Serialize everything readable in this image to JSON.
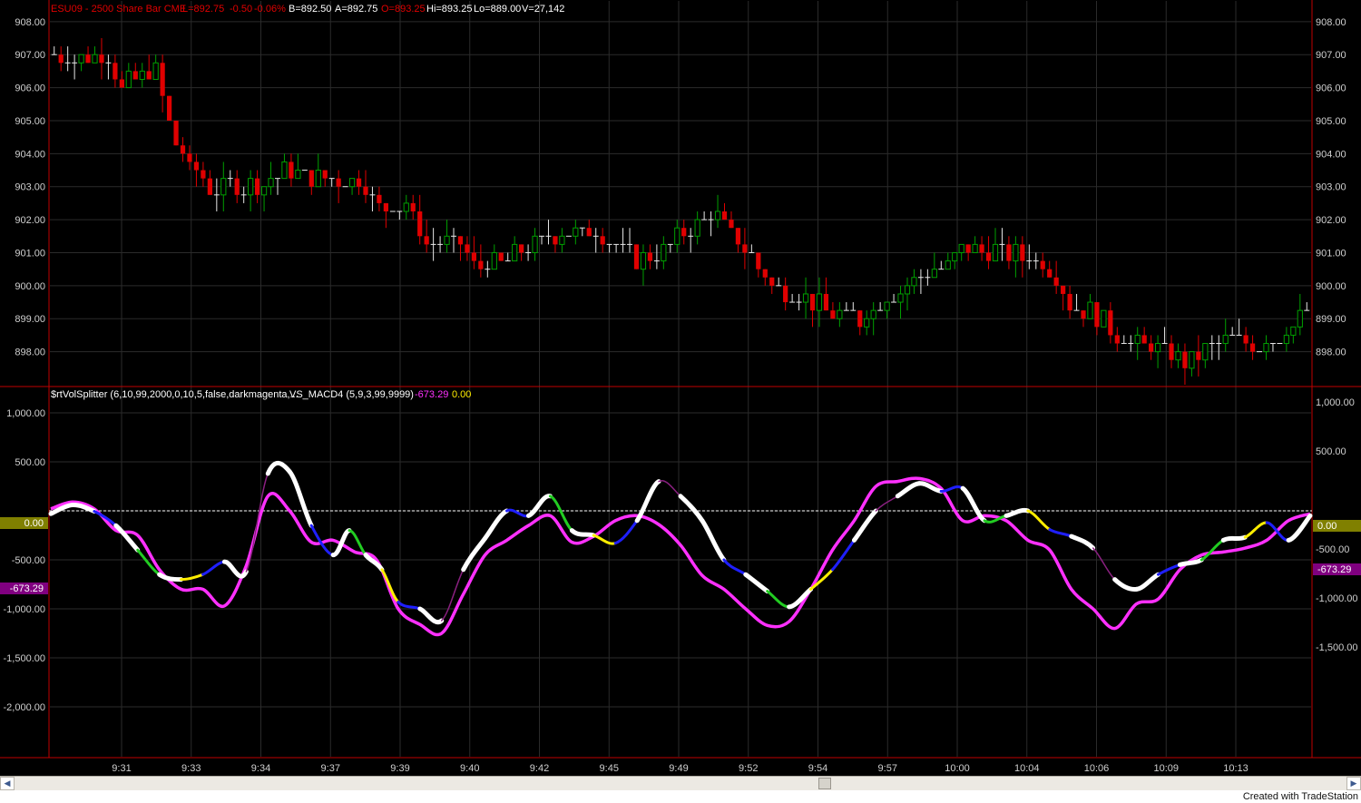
{
  "colors": {
    "background": "#000000",
    "border": "#c00000",
    "grid": "#2b2b2b",
    "axis_text": "#cfcfcf",
    "candle_up": "#00a000",
    "candle_down": "#e00000",
    "candle_doji": "#e8e8e8",
    "signal_line": "#ff30ff",
    "zero_line": "#ffffff",
    "zero_marker_bg": "#808000",
    "value_marker_bg": "#800080",
    "macd_colors": {
      "white": "#ffffff",
      "blue": "#1f1fff",
      "green": "#22cc22",
      "yellow": "#ffee00",
      "purple": "#8a2080"
    }
  },
  "header": {
    "symbol_info": "ESU09 - 2500 Share Bar  CME",
    "last": "L=892.75",
    "change": "-0.50",
    "change_pct": "-0.06%",
    "bid": "B=892.50",
    "ask": "A=892.75",
    "open": "O=893.25",
    "high": "Hi=893.25",
    "low": "Lo=889.00",
    "volume": "V=27,142"
  },
  "indicator_header": {
    "study": "$rtVolSplitter (6,10,99,2000,0,10,5,false,darkmagenta,...",
    "macd": "VS_MACD4 (5,9,3,99,9999)",
    "value1": "-673.29",
    "value2": "0.00"
  },
  "markers": {
    "left_zero": "0.00",
    "left_value": "-673.29",
    "right_zero": "0.00",
    "right_value": "-673.29"
  },
  "footer": {
    "scroll_left": "◀",
    "scroll_right": "▶",
    "credit": "Created with TradeStation"
  },
  "chart_data": [
    {
      "type": "candlestick",
      "price_ticks": [
        "908.00",
        "907.00",
        "906.00",
        "905.00",
        "904.00",
        "903.00",
        "902.00",
        "901.00",
        "900.00",
        "899.00",
        "898.00"
      ],
      "ylim": [
        897.0,
        908.6
      ],
      "time_labels": [
        "9:31",
        "9:33",
        "9:34",
        "9:37",
        "9:39",
        "9:40",
        "9:42",
        "9:45",
        "9:49",
        "9:52",
        "9:54",
        "9:57",
        "10:00",
        "10:04",
        "10:06",
        "10:09",
        "10:13"
      ],
      "close_path": [
        [
          0,
          907.0
        ],
        [
          5,
          906.8
        ],
        [
          8,
          907.1
        ],
        [
          10,
          906.0
        ],
        [
          13,
          906.4
        ],
        [
          15,
          906.5
        ],
        [
          17,
          904.8
        ],
        [
          20,
          903.6
        ],
        [
          23,
          903.0
        ],
        [
          30,
          903.0
        ],
        [
          34,
          903.5
        ],
        [
          40,
          903.2
        ],
        [
          45,
          903.3
        ],
        [
          48,
          902.4
        ],
        [
          52,
          902.5
        ],
        [
          55,
          901.3
        ],
        [
          60,
          901.2
        ],
        [
          62,
          900.6
        ],
        [
          67,
          900.8
        ],
        [
          70,
          901.2
        ],
        [
          75,
          901.6
        ],
        [
          80,
          901.6
        ],
        [
          83,
          901.2
        ],
        [
          86,
          900.8
        ],
        [
          90,
          901.0
        ],
        [
          93,
          901.6
        ],
        [
          97,
          902.2
        ],
        [
          100,
          901.6
        ],
        [
          104,
          900.6
        ],
        [
          106,
          900.0
        ],
        [
          110,
          899.7
        ],
        [
          115,
          899.2
        ],
        [
          119,
          899.0
        ],
        [
          123,
          899.6
        ],
        [
          127,
          900.2
        ],
        [
          131,
          900.5
        ],
        [
          134,
          901.0
        ],
        [
          137,
          901.1
        ],
        [
          140,
          901.0
        ],
        [
          145,
          900.8
        ],
        [
          148,
          900.4
        ],
        [
          150,
          899.5
        ],
        [
          153,
          899.2
        ],
        [
          157,
          898.6
        ],
        [
          160,
          898.2
        ],
        [
          164,
          898.0
        ],
        [
          167,
          897.6
        ],
        [
          170,
          898.0
        ],
        [
          173,
          898.3
        ],
        [
          177,
          898.2
        ],
        [
          180,
          898.4
        ],
        [
          183,
          898.8
        ],
        [
          185,
          899.3
        ]
      ],
      "bar_count": 186
    },
    {
      "type": "line",
      "y_ticks_left": [
        "1,000.00",
        "500.00",
        "0.00",
        "-500.00",
        "-1,000.00",
        "-1,500.00",
        "-2,000.00"
      ],
      "y_ticks_right": [
        "1,000.00",
        "500.00",
        "0.00",
        "-500.00",
        "-1,000.00",
        "-1,500.00"
      ],
      "ylim": [
        -2500,
        1250
      ],
      "series": [
        {
          "points": [
            [
              0,
              -30
            ],
            [
              4,
              60
            ],
            [
              8,
              -5
            ],
            [
              12,
              -150
            ],
            [
              16,
              -400
            ],
            [
              20,
              -650
            ],
            [
              24,
              -700
            ],
            [
              28,
              -650
            ],
            [
              32,
              -520
            ],
            [
              36,
              -620
            ],
            [
              40,
              380
            ],
            [
              44,
              400
            ],
            [
              48,
              -150
            ],
            [
              52,
              -450
            ],
            [
              55,
              -200
            ],
            [
              58,
              -450
            ],
            [
              61,
              -600
            ],
            [
              64,
              -930
            ],
            [
              68,
              -1000
            ],
            [
              72,
              -1120
            ],
            [
              76,
              -600
            ],
            [
              80,
              -280
            ],
            [
              84,
              0
            ],
            [
              88,
              -50
            ],
            [
              92,
              150
            ],
            [
              96,
              -200
            ],
            [
              100,
              -250
            ],
            [
              104,
              -330
            ],
            [
              108,
              -100
            ],
            [
              112,
              300
            ],
            [
              116,
              150
            ],
            [
              120,
              -100
            ],
            [
              124,
              -500
            ],
            [
              128,
              -650
            ],
            [
              132,
              -820
            ],
            [
              136,
              -980
            ],
            [
              140,
              -800
            ],
            [
              144,
              -600
            ],
            [
              148,
              -300
            ],
            [
              152,
              0
            ],
            [
              156,
              150
            ],
            [
              160,
              280
            ],
            [
              164,
              200
            ],
            [
              168,
              230
            ],
            [
              172,
              -100
            ],
            [
              176,
              -50
            ],
            [
              180,
              0
            ],
            [
              184,
              -190
            ],
            [
              188,
              -260
            ],
            [
              192,
              -380
            ],
            [
              196,
              -700
            ],
            [
              200,
              -800
            ],
            [
              204,
              -650
            ],
            [
              208,
              -550
            ],
            [
              212,
              -500
            ],
            [
              216,
              -300
            ],
            [
              220,
              -270
            ],
            [
              224,
              -120
            ],
            [
              228,
              -300
            ],
            [
              232,
              -50
            ]
          ]
        },
        {
          "points": [
            [
              0,
              20
            ],
            [
              4,
              90
            ],
            [
              8,
              20
            ],
            [
              12,
              -200
            ],
            [
              16,
              -250
            ],
            [
              20,
              -600
            ],
            [
              24,
              -800
            ],
            [
              28,
              -800
            ],
            [
              32,
              -970
            ],
            [
              36,
              -560
            ],
            [
              40,
              150
            ],
            [
              44,
              0
            ],
            [
              48,
              -320
            ],
            [
              52,
              -300
            ],
            [
              56,
              -420
            ],
            [
              60,
              -500
            ],
            [
              64,
              -1000
            ],
            [
              68,
              -1160
            ],
            [
              72,
              -1250
            ],
            [
              76,
              -850
            ],
            [
              80,
              -450
            ],
            [
              84,
              -300
            ],
            [
              88,
              -150
            ],
            [
              92,
              -50
            ],
            [
              96,
              -320
            ],
            [
              100,
              -260
            ],
            [
              104,
              -100
            ],
            [
              108,
              -50
            ],
            [
              112,
              -140
            ],
            [
              116,
              -350
            ],
            [
              120,
              -660
            ],
            [
              124,
              -800
            ],
            [
              128,
              -1000
            ],
            [
              132,
              -1170
            ],
            [
              136,
              -1130
            ],
            [
              140,
              -800
            ],
            [
              144,
              -400
            ],
            [
              148,
              -100
            ],
            [
              152,
              250
            ],
            [
              156,
              300
            ],
            [
              160,
              330
            ],
            [
              164,
              230
            ],
            [
              168,
              -100
            ],
            [
              172,
              -50
            ],
            [
              176,
              -100
            ],
            [
              180,
              -300
            ],
            [
              184,
              -400
            ],
            [
              188,
              -800
            ],
            [
              192,
              -1000
            ],
            [
              196,
              -1200
            ],
            [
              200,
              -950
            ],
            [
              204,
              -900
            ],
            [
              208,
              -600
            ],
            [
              212,
              -450
            ],
            [
              216,
              -420
            ],
            [
              220,
              -380
            ],
            [
              224,
              -300
            ],
            [
              228,
              -100
            ],
            [
              232,
              -30
            ]
          ]
        }
      ]
    }
  ]
}
